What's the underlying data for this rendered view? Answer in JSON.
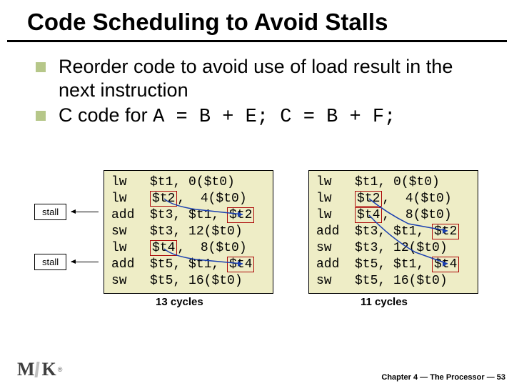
{
  "title": "Code Scheduling to Avoid Stalls",
  "bullets": [
    "Reorder code to avoid use of load result in the next instruction",
    "C code for A = B + E; C = B + F;"
  ],
  "c_code": "A = B + E; C = B + F;",
  "left_code": {
    "lines": [
      {
        "op": "lw",
        "a1": "$t1,",
        "a2": "0($t0)"
      },
      {
        "op": "lw",
        "a1_hl": "$t2",
        "a1_suffix": ",",
        "a2": "4($t0)"
      },
      {
        "op": "add",
        "a1": "$t3,",
        "a2": "$t1, ",
        "a2_hl": "$t2"
      },
      {
        "op": "sw",
        "a1": "$t3,",
        "a2": "12($t0)"
      },
      {
        "op": "lw",
        "a1_hl": "$t4",
        "a1_suffix": ",",
        "a2": "8($t0)"
      },
      {
        "op": "add",
        "a1": "$t5,",
        "a2": "$t1, ",
        "a2_hl": "$t4"
      },
      {
        "op": "sw",
        "a1": "$t5,",
        "a2": "16($t0)"
      }
    ],
    "cycles": "13 cycles"
  },
  "right_code": {
    "lines": [
      {
        "op": "lw",
        "a1": "$t1,",
        "a2": "0($t0)"
      },
      {
        "op": "lw",
        "a1_hl": "$t2",
        "a1_suffix": ",",
        "a2": "4($t0)"
      },
      {
        "op": "lw",
        "a1_hl": "$t4",
        "a1_suffix": ",",
        "a2": "8($t0)"
      },
      {
        "op": "add",
        "a1": "$t3,",
        "a2": "$t1, ",
        "a2_hl": "$t2"
      },
      {
        "op": "sw",
        "a1": "$t3,",
        "a2": "12($t0)"
      },
      {
        "op": "add",
        "a1": "$t5,",
        "a2": "$t1, ",
        "a2_hl": "$t4"
      },
      {
        "op": "sw",
        "a1": "$t5,",
        "a2": "16($t0)"
      }
    ],
    "cycles": "11 cycles"
  },
  "stall_label": "stall",
  "footer": "Chapter 4 — The Processor — 53"
}
